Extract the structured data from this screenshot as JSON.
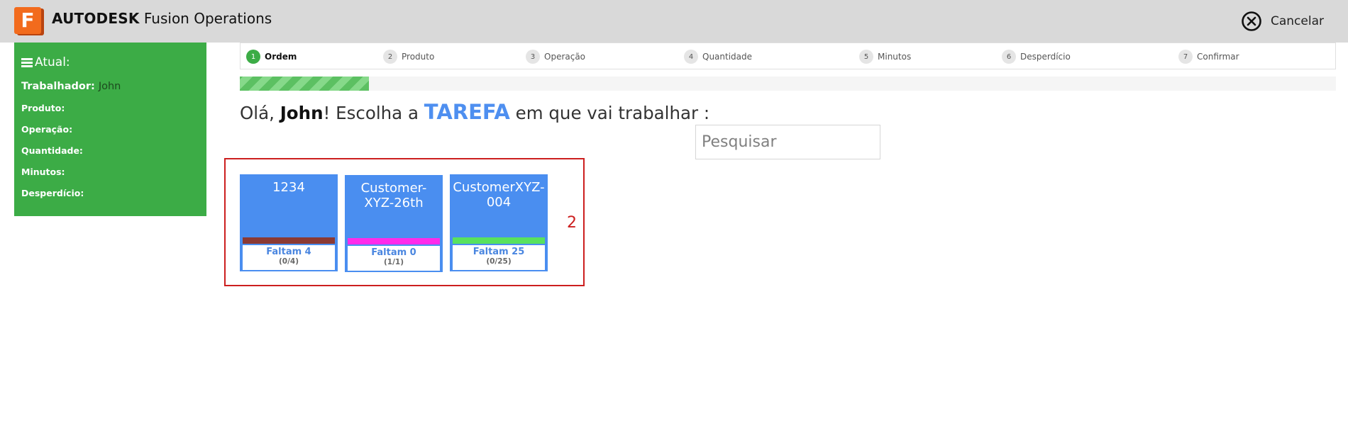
{
  "header": {
    "logo_letter": "F",
    "brand_bold": "AUTODESK",
    "brand_rest": "Fusion Operations",
    "cancel_label": "Cancelar",
    "cancel_icon": "close-circle-icon"
  },
  "sidebar": {
    "title": "Atual:",
    "worker_label": "Trabalhador:",
    "worker_value": "John",
    "fields": [
      "Produto:",
      "Operação:",
      "Quantidade:",
      "Minutos:",
      "Desperdício:"
    ]
  },
  "stepper": {
    "steps": [
      {
        "num": "1",
        "label": "Ordem",
        "active": true
      },
      {
        "num": "2",
        "label": "Produto"
      },
      {
        "num": "3",
        "label": "Operação"
      },
      {
        "num": "4",
        "label": "Quantidade"
      },
      {
        "num": "5",
        "label": "Minutos"
      },
      {
        "num": "6",
        "label": "Desperdício"
      },
      {
        "num": "7",
        "label": "Confirmar"
      }
    ]
  },
  "progress": {
    "fraction": 0.118
  },
  "greeting": {
    "hello": "Olá, ",
    "name": "John",
    "mid": "! Escolha a ",
    "task": "TAREFA",
    "end": " em que vai trabalhar :"
  },
  "search": {
    "placeholder": "Pesquisar",
    "value": ""
  },
  "annotation": "2",
  "orders": [
    {
      "title": "1234",
      "bar_color": "#8b3a34",
      "remaining": "Faltam 4",
      "ratio": "(0/4)"
    },
    {
      "title": "Customer-XYZ-26th",
      "bar_color": "#ff2bea",
      "remaining": "Faltam 0",
      "ratio": "(1/1)"
    },
    {
      "title": "CustomerXYZ-004",
      "bar_color": "#58e15e",
      "remaining": "Faltam 25",
      "ratio": "(0/25)"
    }
  ],
  "colors": {
    "accent_green": "#3cac46",
    "card_blue": "#4a8ef0",
    "task_blue": "#4e8ff0",
    "annotation_red": "#cc1f1f"
  }
}
